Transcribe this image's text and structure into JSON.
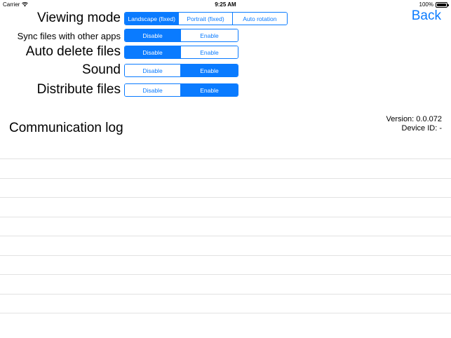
{
  "status_bar": {
    "carrier": "Carrier",
    "time": "9:25 AM",
    "battery": "100%",
    "battery_level": 1.0
  },
  "settings": [
    {
      "label": "Viewing mode",
      "options": [
        "Landscape (fixed)",
        "Portrait (fixed)",
        "Auto rotation"
      ],
      "selected": 0
    },
    {
      "label": "Sync files with other apps",
      "options": [
        "Disable",
        "Enable"
      ],
      "selected": 0
    },
    {
      "label": "Auto delete files",
      "options": [
        "Disable",
        "Enable"
      ],
      "selected": 0
    },
    {
      "label": "Sound",
      "options": [
        "Disable",
        "Enable"
      ],
      "selected": 1
    },
    {
      "label": "Distribute files",
      "options": [
        "Disable",
        "Enable"
      ],
      "selected": 1
    }
  ],
  "nav": {
    "back_label": "Back"
  },
  "comm_log": {
    "title": "Communication log",
    "version": "Version: 0.0.072",
    "device_id": "Device ID: -"
  },
  "colors": {
    "accent": "#0a7bff",
    "separator": "#e2e2e2"
  }
}
